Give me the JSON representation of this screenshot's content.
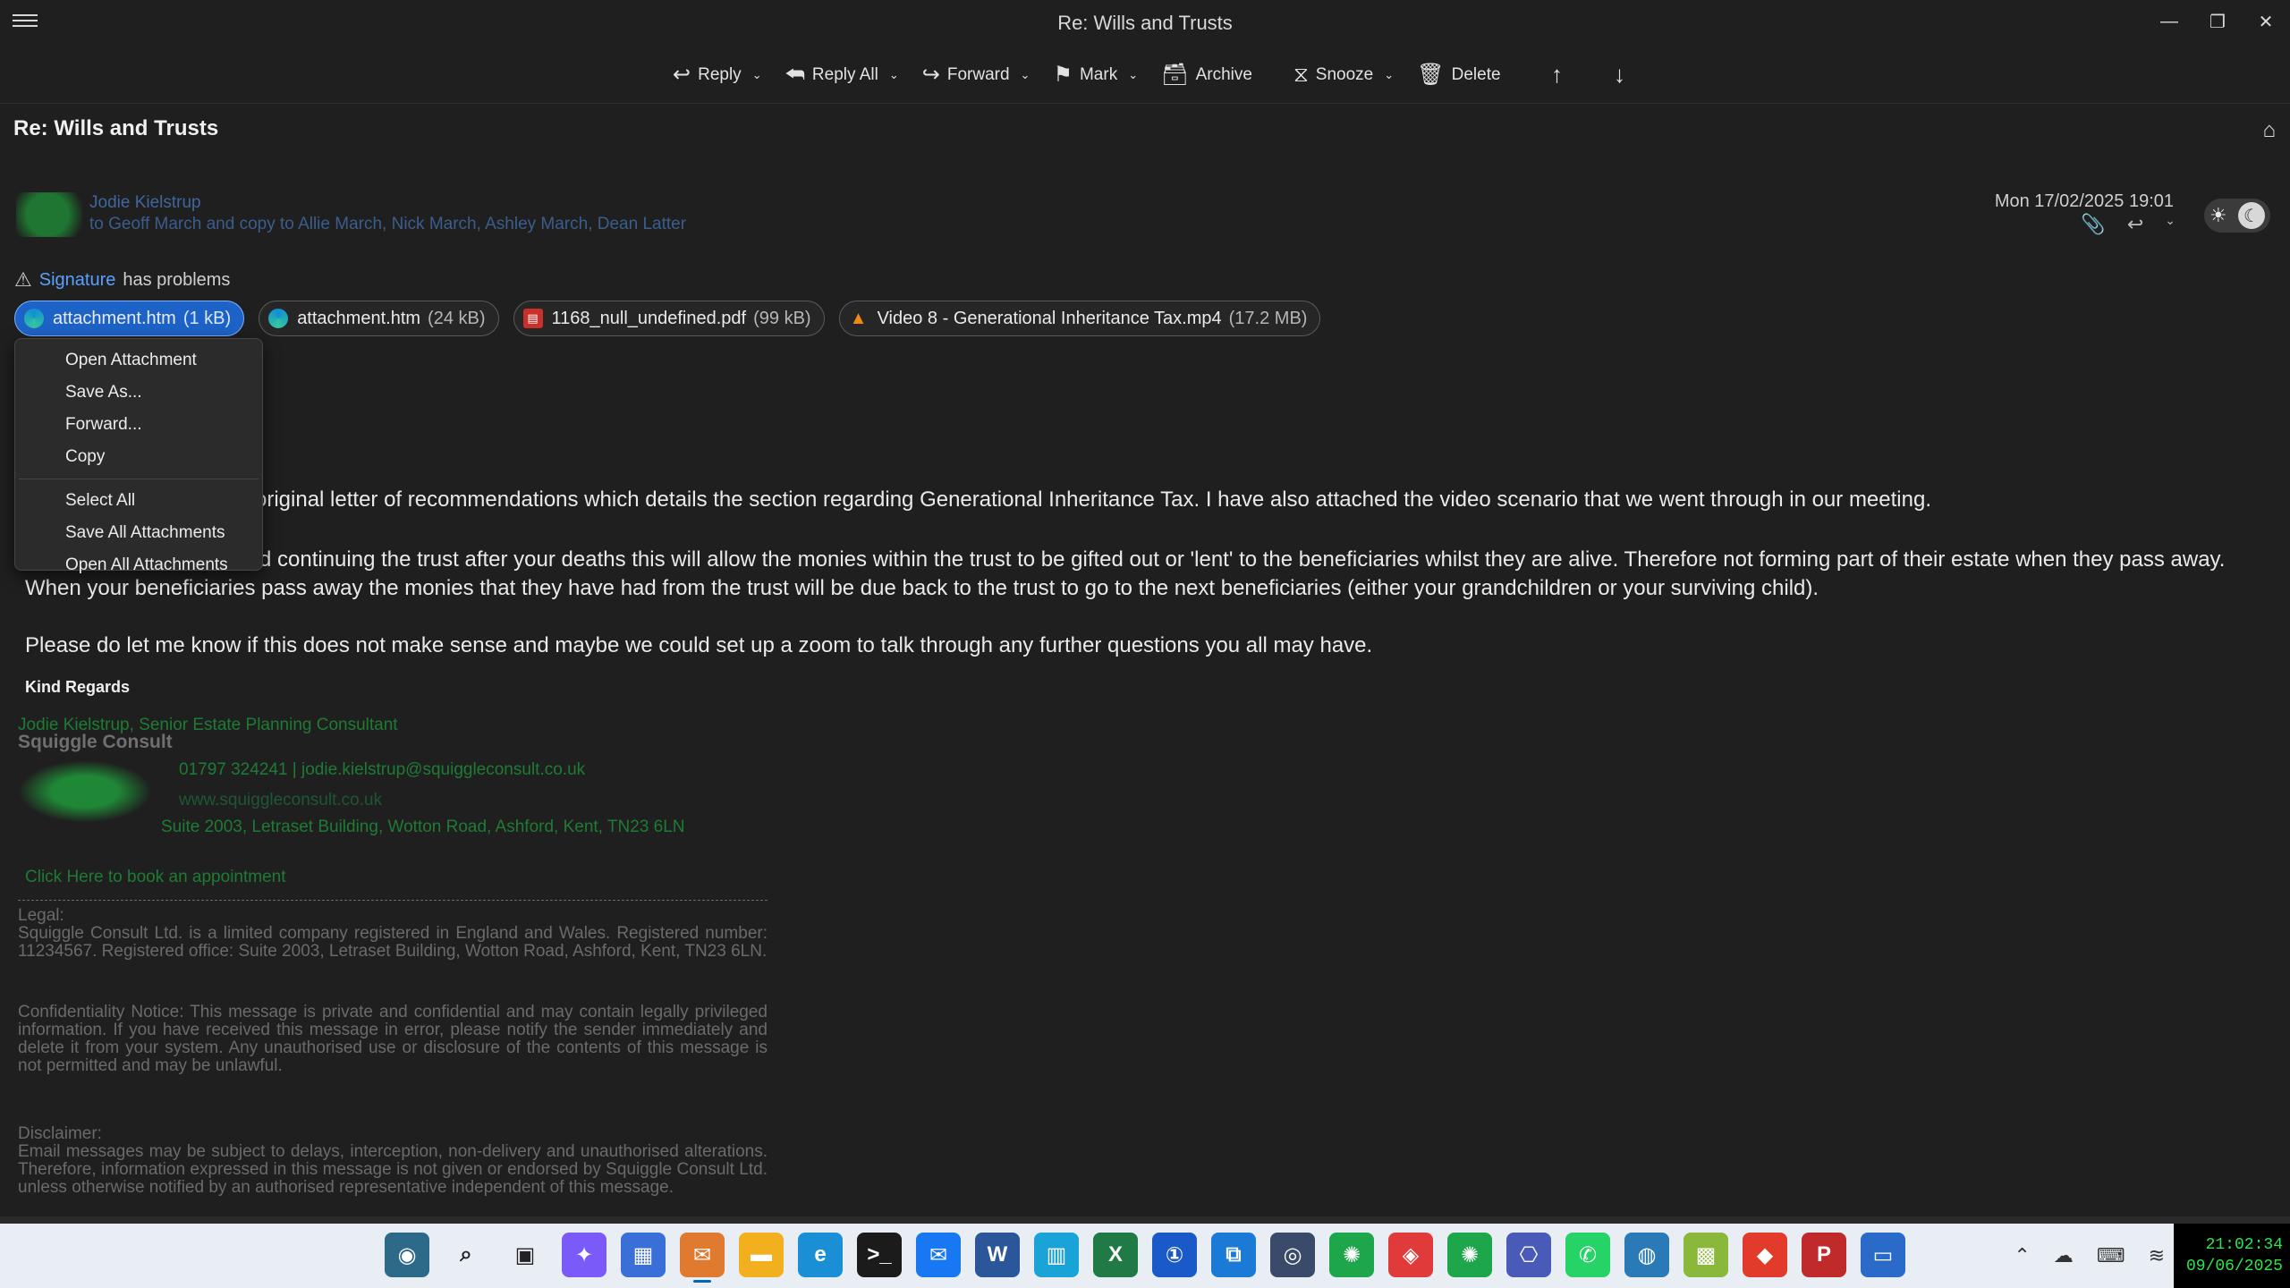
{
  "window": {
    "title": "Re: Wills and Trusts",
    "controls": [
      "—",
      "❐",
      "✕"
    ]
  },
  "toolbar": {
    "reply": "Reply",
    "reply_all": "Reply All",
    "forward": "Forward",
    "mark": "Mark",
    "archive": "Archive",
    "snooze": "Snooze",
    "delete": "Delete"
  },
  "message": {
    "subject": "Re: Wills and Trusts",
    "sender": "Jodie Kielstrup",
    "recipients": "to Geoff March and copy to Allie March, Nick March, Ashley March, Dean Latter",
    "date": "Mon 17/02/2025 19:01"
  },
  "signature_warning": {
    "link": "Signature",
    "text": "has problems"
  },
  "attachments": [
    {
      "name": "attachment.htm",
      "size": "(1 kB)",
      "icon": "edge-icon"
    },
    {
      "name": "attachment.htm",
      "size": "(24 kB)",
      "icon": "edge-icon"
    },
    {
      "name": "1168_null_undefined.pdf",
      "size": "(99 kB)",
      "icon": "pdf-icon"
    },
    {
      "name": "Video 8 - Generational Inheritance Tax.mp4",
      "size": "(17.2 MB)",
      "icon": "vlc-icon"
    }
  ],
  "context_menu": {
    "open": "Open Attachment",
    "save_as": "Save As...",
    "forward": "Forward...",
    "copy": "Copy",
    "select_all": "Select All",
    "save_all": "Save All Attachments",
    "open_all": "Open All Attachments"
  },
  "body": {
    "p1": "original letter of recommendations which details the section regarding Generational Inheritance Tax. I have also attached the video scenario that we went through in our meeting.",
    "p2": "d continuing the trust after your deaths this will allow the monies within the trust to be gifted out or 'lent' to the beneficiaries whilst they are alive. Therefore not forming part of their estate when they pass away.",
    "p2b": "When your beneficiaries pass away the monies that they have had from the trust will be due back to the trust to go to the next beneficiaries (either your grandchildren or your surviving child).",
    "p3": "Please do let me know if this does not make sense and maybe we could set up a zoom to talk through any further questions you all may have.",
    "regards": "Kind Regards"
  },
  "signature": {
    "name": "Jodie Kielstrup, Senior Estate Planning Consultant",
    "company": "Squiggle Consult",
    "phone": "01797 324241 | jodie.kielstrup@squiggleconsult.co.uk",
    "web": "www.squiggleconsult.co.uk",
    "address": "Suite 2003, Letraset Building, Wotton Road, Ashford, Kent, TN23 6LN",
    "book": "Click Here to book an appointment"
  },
  "legal": {
    "heading": "Legal:",
    "text1": "Squiggle Consult Ltd. is a limited company registered in England and Wales. Registered number: 11234567. Registered office: Suite 2003, Letraset Building, Wotton Road, Ashford, Kent, TN23 6LN.",
    "text2": "Confidentiality Notice: This message is private and confidential and may contain legally privileged information. If you have received this message in error, please notify the sender immediately and delete it from your system. Any unauthorised use or disclosure of the contents of this message is not permitted and may be unlawful.",
    "heading3": "Disclaimer:",
    "text3": "Email messages may be subject to delays, interception, non-delivery and unauthorised alterations. Therefore, information expressed in this message is not given or endorsed by Squiggle Consult Ltd. unless otherwise notified by an authorised representative independent of this message."
  },
  "taskbar": {
    "icons": [
      {
        "name": "widgets-icon",
        "color": "#2d6a8a",
        "glyph": "◉"
      },
      {
        "name": "search-icon",
        "color": "#e9eef5",
        "glyph": "⌕"
      },
      {
        "name": "taskview-icon",
        "color": "#e9eef5",
        "glyph": "▣"
      },
      {
        "name": "copilot-icon",
        "color": "#7a5af8",
        "glyph": "✦"
      },
      {
        "name": "calendar-icon",
        "color": "#3a6fd8",
        "glyph": "▦"
      },
      {
        "name": "thunderbird-icon",
        "color": "#e07a2e",
        "glyph": "✉"
      },
      {
        "name": "file-explorer-icon",
        "color": "#f2b01e",
        "glyph": "▬"
      },
      {
        "name": "edge-icon",
        "color": "#1a8fd6",
        "glyph": "e"
      },
      {
        "name": "terminal-icon",
        "color": "#1b1b1b",
        "glyph": ">_"
      },
      {
        "name": "messenger-icon",
        "color": "#1877f2",
        "glyph": "✉"
      },
      {
        "name": "word-icon",
        "color": "#2b579a",
        "glyph": "W"
      },
      {
        "name": "azure-data-icon",
        "color": "#1aa3d6",
        "glyph": "▥"
      },
      {
        "name": "excel-icon",
        "color": "#1f7a45",
        "glyph": "X"
      },
      {
        "name": "1password-icon",
        "color": "#1a5ac8",
        "glyph": "①"
      },
      {
        "name": "remote-desktop-icon",
        "color": "#1a7ad6",
        "glyph": "⧉"
      },
      {
        "name": "camera-icon",
        "color": "#3a4a6a",
        "glyph": "◎"
      },
      {
        "name": "app-green-1-icon",
        "color": "#1ea64a",
        "glyph": "✺"
      },
      {
        "name": "app-red-icon",
        "color": "#e03a3a",
        "glyph": "◈"
      },
      {
        "name": "app-green-2-icon",
        "color": "#1ea64a",
        "glyph": "✺"
      },
      {
        "name": "network-icon",
        "color": "#4a5ab8",
        "glyph": "⎔"
      },
      {
        "name": "whatsapp-icon",
        "color": "#25d366",
        "glyph": "✆"
      },
      {
        "name": "vpn-icon",
        "color": "#2a7ab8",
        "glyph": "◍"
      },
      {
        "name": "app-checker-icon",
        "color": "#8ab83a",
        "glyph": "▩"
      },
      {
        "name": "anydesk-icon",
        "color": "#e33b2b",
        "glyph": "◆"
      },
      {
        "name": "pdf-app-icon",
        "color": "#c02a2a",
        "glyph": "P"
      },
      {
        "name": "monitor-icon",
        "color": "#2a6ac8",
        "glyph": "▭"
      }
    ],
    "clock_time": "21:02:34",
    "clock_date": "09/06/2025"
  }
}
